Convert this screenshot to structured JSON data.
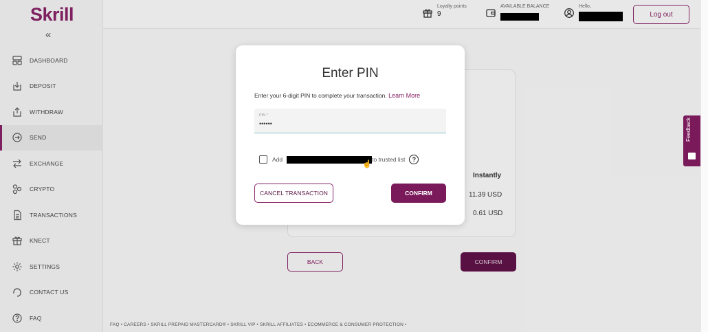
{
  "brand": {
    "logo": "Skrill",
    "accent": "#862165"
  },
  "sidebar": {
    "collapse_label": "«",
    "items": [
      {
        "label": "DASHBOARD",
        "icon": "dashboard-icon"
      },
      {
        "label": "DEPOSIT",
        "icon": "deposit-icon"
      },
      {
        "label": "WITHDRAW",
        "icon": "withdraw-icon"
      },
      {
        "label": "SEND",
        "icon": "send-icon",
        "active": true
      },
      {
        "label": "EXCHANGE",
        "icon": "exchange-icon"
      },
      {
        "label": "CRYPTO",
        "icon": "crypto-icon"
      },
      {
        "label": "TRANSACTIONS",
        "icon": "transactions-icon"
      },
      {
        "label": "KNECT",
        "icon": "gift-icon"
      },
      {
        "label": "SETTINGS",
        "icon": "gear-icon"
      },
      {
        "label": "CONTACT US",
        "icon": "headset-icon"
      },
      {
        "label": "FAQ",
        "icon": "question-icon"
      }
    ]
  },
  "header": {
    "loyalty_label": "Loyalty points",
    "loyalty_value": "9",
    "balance_label": "AVAILABLE BALANCE",
    "hello_label": "Hello,",
    "logout_label": "Log out"
  },
  "background": {
    "column_header": "Instantly",
    "amount_1": "11.39 USD",
    "amount_2": "0.61 USD",
    "back_label": "BACK",
    "confirm_label": "CONFIRM"
  },
  "modal": {
    "title": "Enter PIN",
    "description": "Enter your 6-digit PIN to complete your transaction.",
    "learn_more": "Learn More",
    "pin_label": "PIN *",
    "pin_value": "••••••",
    "trust_prefix": "Add",
    "trust_suffix": "to trusted list",
    "help_symbol": "?",
    "cancel_label": "CANCEL TRANSACTION",
    "confirm_label": "CONFIRM"
  },
  "footer": {
    "links": "FAQ  •  CAREERS  •  SKRILL PREPAID MASTERCARD®  •  SKRILL VIP  •  SKRILL AFFILIATES  •  ECOMMERCE & CONSUMER PROTECTION  •"
  },
  "feedback": {
    "label": "Feedback"
  }
}
